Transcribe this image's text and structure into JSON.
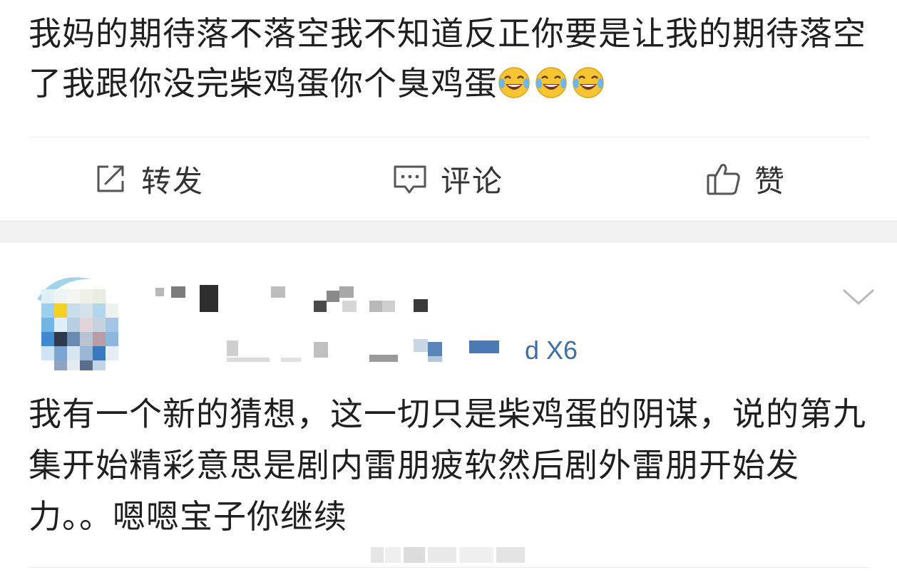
{
  "post": {
    "text": "我妈的期待落不落空我不知道反正你要是让我的期待落空了我跟你没完柴鸡蛋你个臭鸡蛋",
    "emojis": [
      "laugh-cry-emoji",
      "laugh-cry-emoji",
      "laugh-cry-emoji"
    ]
  },
  "actions": {
    "repost_label": "转发",
    "comment_label": "评论",
    "like_label": "赞"
  },
  "comment": {
    "device_suffix": "d X6",
    "text": "我有一个新的猜想，这一切只是柴鸡蛋的阴谋，说的第九集开始精彩意思是剧内雷朋疲软然后剧外雷朋开始发力。。嗯嗯宝子你继续"
  },
  "colors": {
    "link_blue": "#3e6fa8",
    "gap_gray": "#f2f2f2",
    "icon_gray": "#555555"
  }
}
